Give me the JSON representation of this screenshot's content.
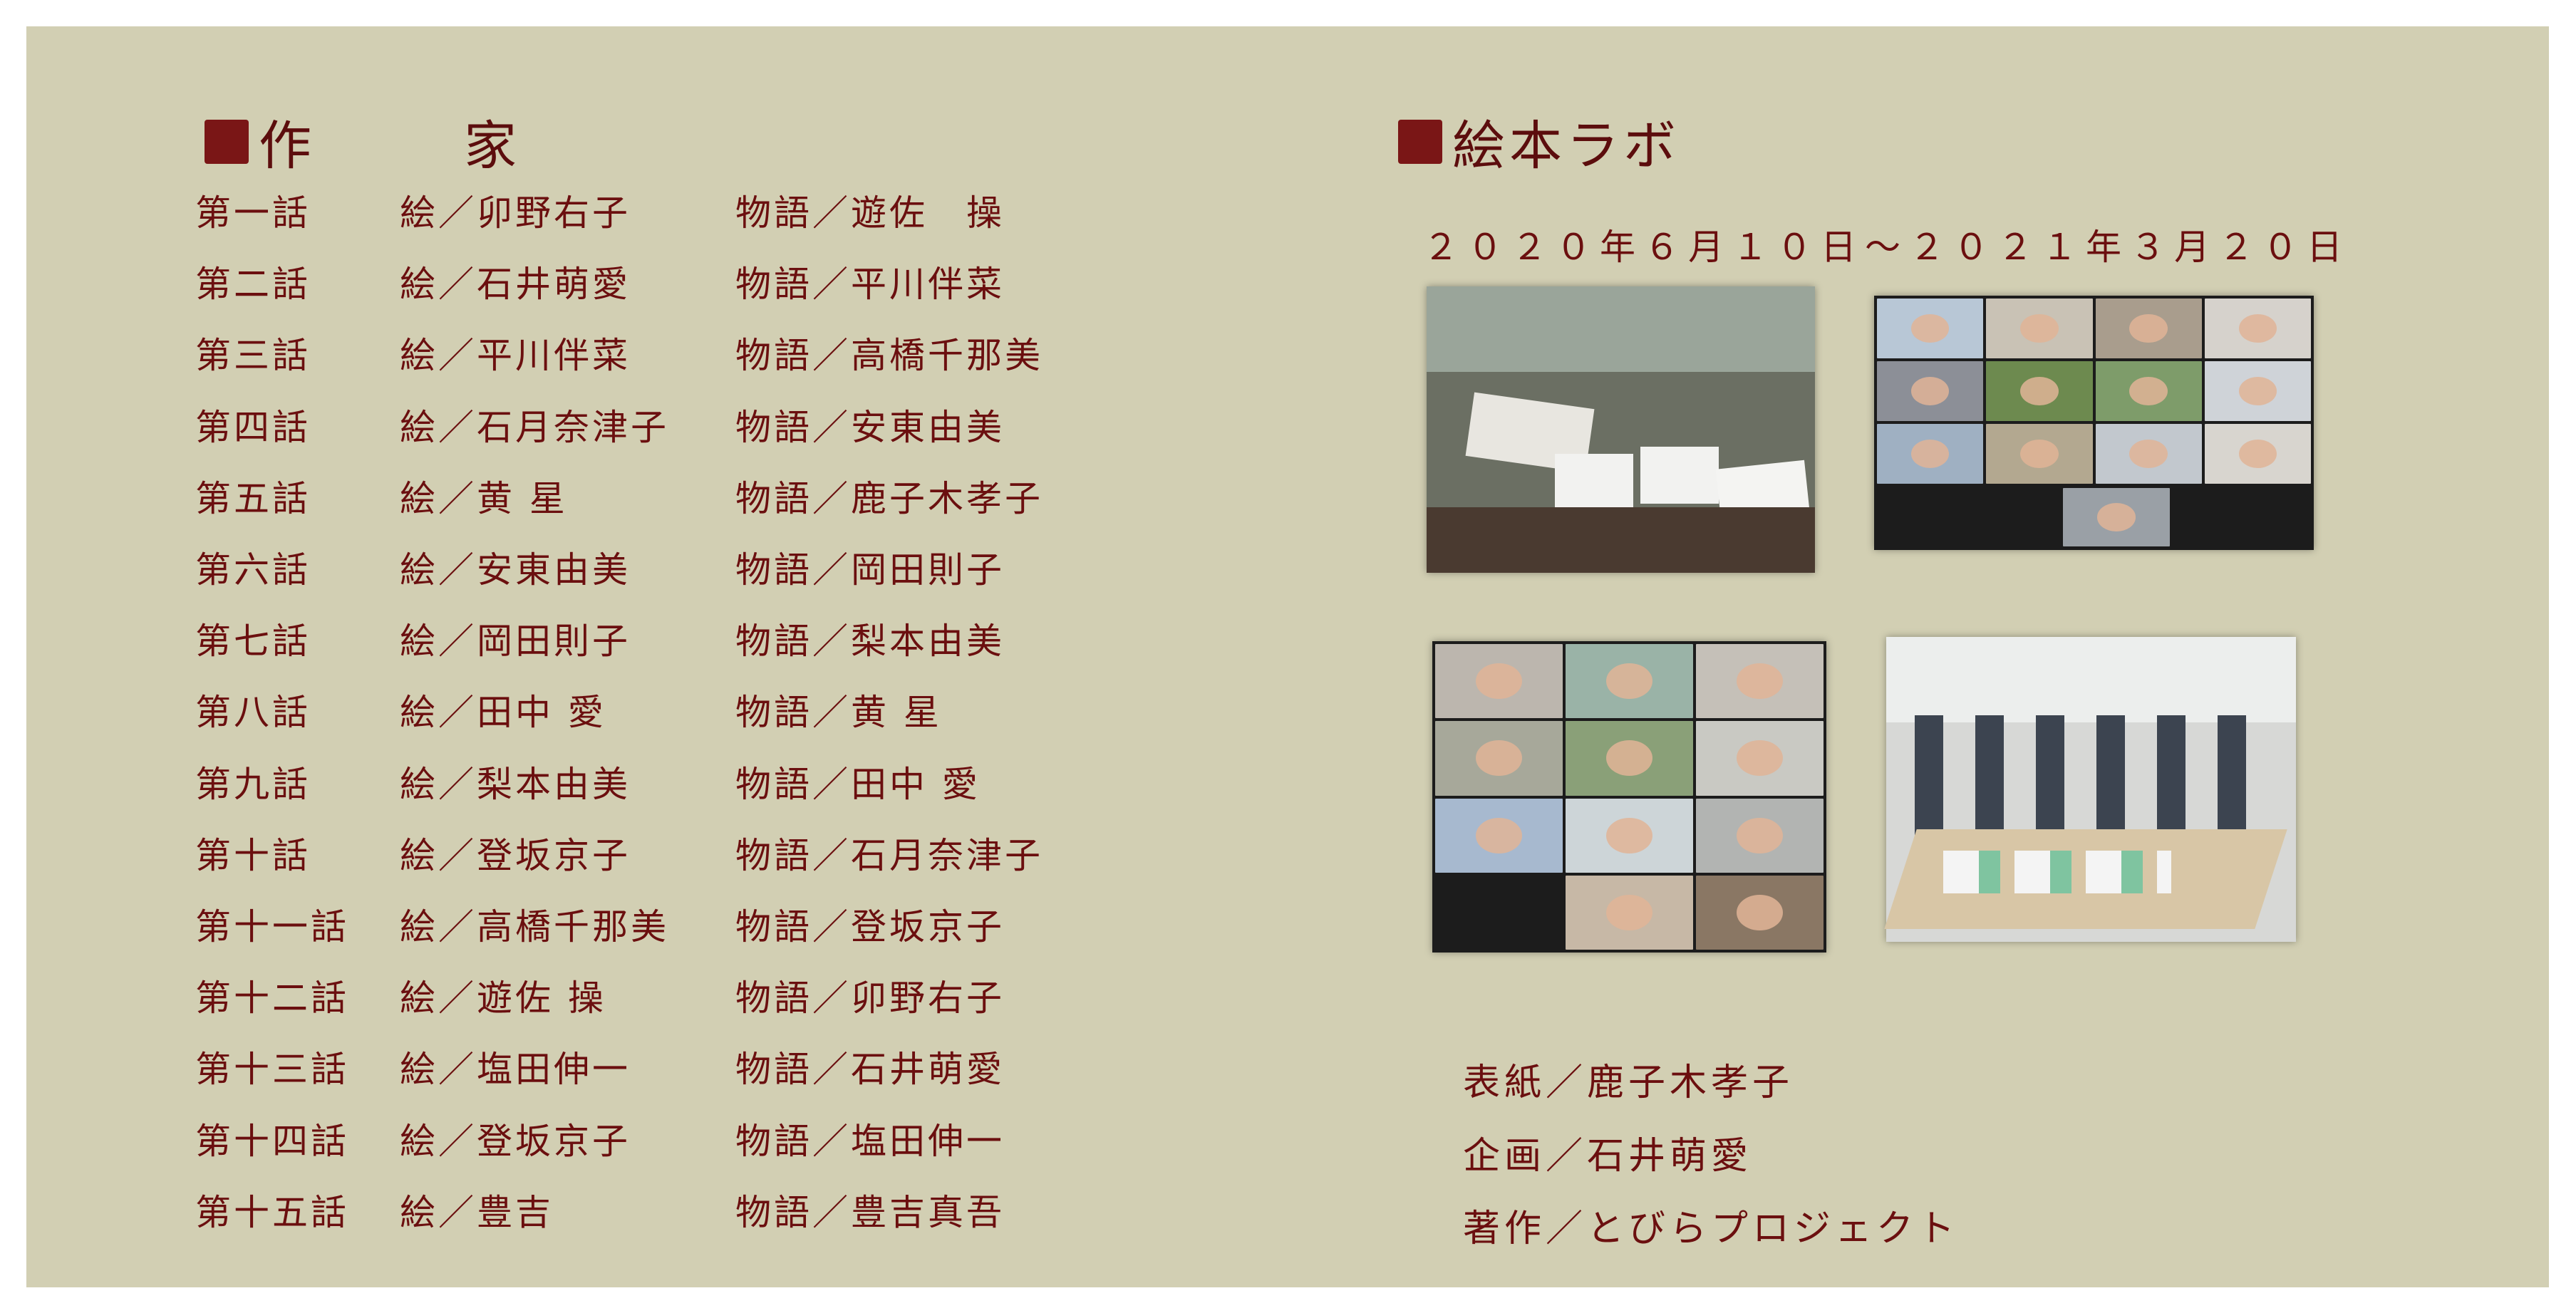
{
  "writers_heading": "作　家",
  "lab_heading": "絵本ラボ",
  "lab_dates": "２０２０年６月１０日～２０２１年３月２０日",
  "credits": [
    {
      "episode": "第一話",
      "art": "絵／卯野右子",
      "story": "物語／遊佐　操"
    },
    {
      "episode": "第二話",
      "art": "絵／石井萌愛",
      "story": "物語／平川伴菜"
    },
    {
      "episode": "第三話",
      "art": "絵／平川伴菜",
      "story": "物語／高橋千那美"
    },
    {
      "episode": "第四話",
      "art": "絵／石月奈津子",
      "story": "物語／安東由美"
    },
    {
      "episode": "第五話",
      "art": "絵／黄 星",
      "story": "物語／鹿子木孝子"
    },
    {
      "episode": "第六話",
      "art": "絵／安東由美",
      "story": "物語／岡田則子"
    },
    {
      "episode": "第七話",
      "art": "絵／岡田則子",
      "story": "物語／梨本由美"
    },
    {
      "episode": "第八話",
      "art": "絵／田中 愛",
      "story": "物語／黄 星"
    },
    {
      "episode": "第九話",
      "art": "絵／梨本由美",
      "story": "物語／田中 愛"
    },
    {
      "episode": "第十話",
      "art": "絵／登坂京子",
      "story": "物語／石月奈津子"
    },
    {
      "episode": "第十一話",
      "art": "絵／高橋千那美",
      "story": "物語／登坂京子"
    },
    {
      "episode": "第十二話",
      "art": "絵／遊佐 操",
      "story": "物語／卯野右子"
    },
    {
      "episode": "第十三話",
      "art": "絵／塩田伸一",
      "story": "物語／石井萌愛"
    },
    {
      "episode": "第十四話",
      "art": "絵／登坂京子",
      "story": "物語／塩田伸一"
    },
    {
      "episode": "第十五話",
      "art": "絵／豊吉",
      "story": "物語／豊吉真吾"
    }
  ],
  "bottom": {
    "cover": "表紙／鹿子木孝子",
    "planning": "企画／石井萌愛",
    "author": "著作／とびらプロジェクト"
  },
  "colors": {
    "background": "#d2cfb3",
    "text": "#6b0f0f",
    "accent": "#7a1616"
  }
}
